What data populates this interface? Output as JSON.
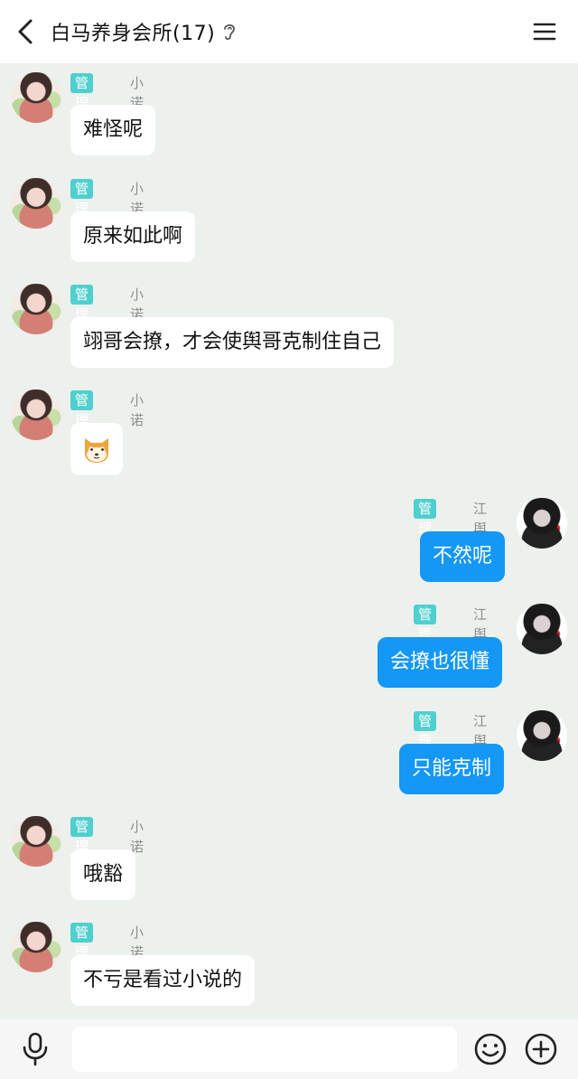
{
  "header": {
    "title": "白马养身会所(17)",
    "back_icon": "chevron-left-icon",
    "ear_icon": "ear-icon",
    "menu_icon": "hamburger-menu-icon"
  },
  "messages": [
    {
      "side": "left",
      "badge": "管理员",
      "name": "小诺",
      "text": "难怪呢"
    },
    {
      "side": "left",
      "badge": "管理员",
      "name": "小诺",
      "text": "原来如此啊"
    },
    {
      "side": "left",
      "badge": "管理员",
      "name": "小诺",
      "text": "翊哥会撩，才会使舆哥克制住自己"
    },
    {
      "side": "left",
      "badge": "管理员",
      "name": "小诺",
      "sticker": "shiba-dog-emoji"
    },
    {
      "side": "right",
      "badge": "管理员",
      "name": "江舆",
      "text": "不然呢"
    },
    {
      "side": "right",
      "badge": "管理员",
      "name": "江舆",
      "text": "会撩也很懂"
    },
    {
      "side": "right",
      "badge": "管理员",
      "name": "江舆",
      "text": "只能克制"
    },
    {
      "side": "left",
      "badge": "管理员",
      "name": "小诺",
      "text": "哦豁"
    },
    {
      "side": "left",
      "badge": "管理员",
      "name": "小诺",
      "text": "不亏是看过小说的"
    }
  ],
  "input": {
    "value": "",
    "placeholder": "",
    "mic_icon": "microphone-icon",
    "emoji_icon": "smiley-icon",
    "plus_icon": "plus-circle-icon"
  },
  "colors": {
    "badge": "#4fd0cf",
    "outgoing_bubble": "#1497f5",
    "background": "#edf1ed"
  }
}
